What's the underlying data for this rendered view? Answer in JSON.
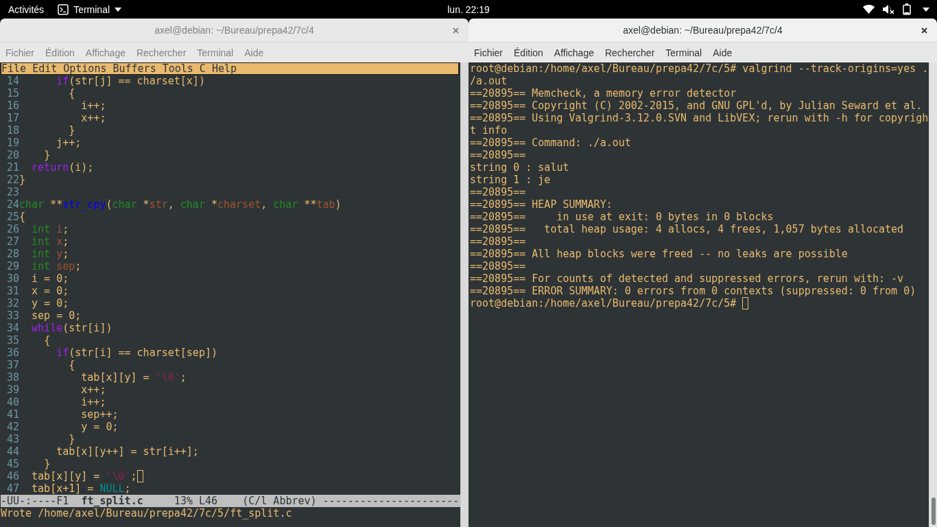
{
  "top_bar": {
    "activities": "Activités",
    "app_menu": "Terminal",
    "clock": "lun. 22:19"
  },
  "windows": [
    {
      "title": "axel@debian: ~/Bureau/prepa42/7c/4",
      "active": false,
      "menus": [
        "Fichier",
        "Édition",
        "Affichage",
        "Rechercher",
        "Terminal",
        "Aide"
      ],
      "content": {
        "kind": "editor",
        "menu_bar": [
          "File",
          "Edit",
          "Options",
          "Buffers",
          "Tools",
          "C",
          "Help"
        ],
        "lines": [
          {
            "number": "14",
            "cursor": false,
            "tokens": [
              {
                "text": "      if",
                "kind": "keyword"
              },
              {
                "text": "(str[j] == charset[x])",
                "kind": "plain"
              }
            ]
          },
          {
            "number": "15",
            "cursor": false,
            "tokens": [
              {
                "text": "        {",
                "kind": "plain"
              }
            ]
          },
          {
            "number": "16",
            "cursor": false,
            "tokens": [
              {
                "text": "          i++;",
                "kind": "plain"
              }
            ]
          },
          {
            "number": "17",
            "cursor": false,
            "tokens": [
              {
                "text": "          x++;",
                "kind": "plain"
              }
            ]
          },
          {
            "number": "18",
            "cursor": false,
            "tokens": [
              {
                "text": "        }",
                "kind": "plain"
              }
            ]
          },
          {
            "number": "19",
            "cursor": false,
            "tokens": [
              {
                "text": "      j++;",
                "kind": "plain"
              }
            ]
          },
          {
            "number": "20",
            "cursor": false,
            "tokens": [
              {
                "text": "    }",
                "kind": "plain"
              }
            ]
          },
          {
            "number": "21",
            "cursor": false,
            "tokens": [
              {
                "text": "  return",
                "kind": "keyword"
              },
              {
                "text": "(i);",
                "kind": "plain"
              }
            ]
          },
          {
            "number": "22",
            "cursor": false,
            "tokens": [
              {
                "text": "}",
                "kind": "plain"
              }
            ]
          },
          {
            "number": "23",
            "cursor": false
          },
          {
            "number": "24",
            "cursor": false,
            "tokens": [
              {
                "text": "char",
                "kind": "type"
              },
              {
                "text": " **",
                "kind": "plain"
              },
              {
                "text": "str_cpy",
                "kind": "function"
              },
              {
                "text": "(",
                "kind": "plain"
              },
              {
                "text": "char",
                "kind": "type"
              },
              {
                "text": " *",
                "kind": "plain"
              },
              {
                "text": "str",
                "kind": "variable"
              },
              {
                "text": ", ",
                "kind": "plain"
              },
              {
                "text": "char",
                "kind": "type"
              },
              {
                "text": " *",
                "kind": "plain"
              },
              {
                "text": "charset",
                "kind": "variable"
              },
              {
                "text": ", ",
                "kind": "plain"
              },
              {
                "text": "char",
                "kind": "type"
              },
              {
                "text": " **",
                "kind": "plain"
              },
              {
                "text": "tab",
                "kind": "variable"
              },
              {
                "text": ")",
                "kind": "plain"
              }
            ]
          },
          {
            "number": "25",
            "cursor": false,
            "tokens": [
              {
                "text": "{",
                "kind": "plain"
              }
            ]
          },
          {
            "number": "26",
            "cursor": false,
            "tokens": [
              {
                "text": "  int",
                "kind": "type"
              },
              {
                "text": " i",
                "kind": "variable"
              },
              {
                "text": ";",
                "kind": "plain"
              }
            ]
          },
          {
            "number": "27",
            "cursor": false,
            "tokens": [
              {
                "text": "  int",
                "kind": "type"
              },
              {
                "text": " x",
                "kind": "variable"
              },
              {
                "text": ";",
                "kind": "plain"
              }
            ]
          },
          {
            "number": "28",
            "cursor": false,
            "tokens": [
              {
                "text": "  int",
                "kind": "type"
              },
              {
                "text": " y",
                "kind": "variable"
              },
              {
                "text": ";",
                "kind": "plain"
              }
            ]
          },
          {
            "number": "29",
            "cursor": false,
            "tokens": [
              {
                "text": "  int",
                "kind": "type"
              },
              {
                "text": " sep",
                "kind": "variable"
              },
              {
                "text": ";",
                "kind": "plain"
              }
            ]
          },
          {
            "number": "30",
            "cursor": false,
            "tokens": [
              {
                "text": "  i = 0;",
                "kind": "plain"
              }
            ]
          },
          {
            "number": "31",
            "cursor": false,
            "tokens": [
              {
                "text": "  x = 0;",
                "kind": "plain"
              }
            ]
          },
          {
            "number": "32",
            "cursor": false,
            "tokens": [
              {
                "text": "  y = 0;",
                "kind": "plain"
              }
            ]
          },
          {
            "number": "33",
            "cursor": false,
            "tokens": [
              {
                "text": "  sep = 0;",
                "kind": "plain"
              }
            ]
          },
          {
            "number": "34",
            "cursor": false,
            "tokens": [
              {
                "text": "  while",
                "kind": "keyword"
              },
              {
                "text": "(str[i])",
                "kind": "plain"
              }
            ]
          },
          {
            "number": "35",
            "cursor": false,
            "tokens": [
              {
                "text": "    {",
                "kind": "plain"
              }
            ]
          },
          {
            "number": "36",
            "cursor": false,
            "tokens": [
              {
                "text": "      if",
                "kind": "keyword"
              },
              {
                "text": "(str[i] == charset[sep])",
                "kind": "plain"
              }
            ]
          },
          {
            "number": "37",
            "cursor": false,
            "tokens": [
              {
                "text": "        {",
                "kind": "plain"
              }
            ]
          },
          {
            "number": "38",
            "cursor": false,
            "tokens": [
              {
                "text": "          tab[x][y] = ",
                "kind": "plain"
              },
              {
                "text": "'\\0'",
                "kind": "string"
              },
              {
                "text": ";",
                "kind": "plain"
              }
            ]
          },
          {
            "number": "39",
            "cursor": false,
            "tokens": [
              {
                "text": "          x++;",
                "kind": "plain"
              }
            ]
          },
          {
            "number": "40",
            "cursor": false,
            "tokens": [
              {
                "text": "          i++;",
                "kind": "plain"
              }
            ]
          },
          {
            "number": "41",
            "cursor": false,
            "tokens": [
              {
                "text": "          sep++;",
                "kind": "plain"
              }
            ]
          },
          {
            "number": "42",
            "cursor": false,
            "tokens": [
              {
                "text": "          y = 0;",
                "kind": "plain"
              }
            ]
          },
          {
            "number": "43",
            "cursor": false,
            "tokens": [
              {
                "text": "        }",
                "kind": "plain"
              }
            ]
          },
          {
            "number": "44",
            "cursor": false,
            "tokens": [
              {
                "text": "      tab[x][y++] = str[i++];",
                "kind": "plain"
              }
            ]
          },
          {
            "number": "45",
            "cursor": false,
            "tokens": [
              {
                "text": "    }",
                "kind": "plain"
              }
            ]
          },
          {
            "number": "46",
            "cursor": true,
            "tokens": [
              {
                "text": "  tab[x][y] = ",
                "kind": "plain"
              },
              {
                "text": "'\\0'",
                "kind": "string"
              },
              {
                "text": ";",
                "kind": "plain"
              }
            ]
          },
          {
            "number": "47",
            "cursor": false,
            "tokens": [
              {
                "text": "  tab[x+1] = ",
                "kind": "plain"
              },
              {
                "text": "NULL",
                "kind": "constant"
              },
              {
                "text": ";",
                "kind": "plain"
              }
            ]
          }
        ],
        "mode_line": "-UU-:----F1  **ft_split.c**     13% L46    (C/l Abbrev) ----------------------",
        "echo": "Wrote /home/axel/Bureau/prepa42/7c/5/ft_split.c"
      }
    },
    {
      "title": "axel@debian: ~/Bureau/prepa42/7c/4",
      "active": true,
      "menus": [
        "Fichier",
        "Édition",
        "Affichage",
        "Rechercher",
        "Terminal",
        "Aide"
      ],
      "content": {
        "kind": "terminal",
        "lines": [
          "root@debian:/home/axel/Bureau/prepa42/7c/5# valgrind --track-origins=yes .",
          "/a.out",
          "==20895== Memcheck, a memory error detector",
          "==20895== Copyright (C) 2002-2015, and GNU GPL'd, by Julian Seward et al.",
          "==20895== Using Valgrind-3.12.0.SVN and LibVEX; rerun with -h for copyrigh",
          "t info",
          "==20895== Command: ./a.out",
          "==20895==",
          "string 0 : salut",
          "string 1 : je",
          "==20895==",
          "==20895== HEAP SUMMARY:",
          "==20895==     in use at exit: 0 bytes in 0 blocks",
          "==20895==   total heap usage: 4 allocs, 4 frees, 1,057 bytes allocated",
          "==20895==",
          "==20895== All heap blocks were freed -- no leaks are possible",
          "==20895==",
          "==20895== For counts of detected and suppressed errors, rerun with: -v",
          "==20895== ERROR SUMMARY: 0 errors from 0 contexts (suppressed: 0 from 0)"
        ],
        "prompt": "root@debian:/home/axel/Bureau/prepa42/7c/5#",
        "cursor": true
      }
    }
  ]
}
